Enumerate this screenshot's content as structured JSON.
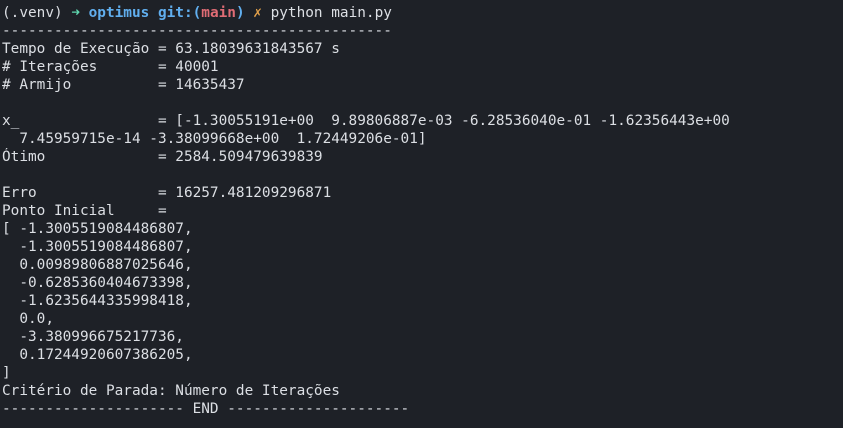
{
  "prompt": {
    "venv": "(.venv) ",
    "arrow": "➜ ",
    "dir": "optimus ",
    "git_open": "git:(",
    "branch": "main",
    "git_close": ")",
    "dirty": " ✗ ",
    "command": "python main.py"
  },
  "output": [
    "---------------------------------------------",
    "Tempo de Execução = 63.18039631843567 s",
    "# Iterações       = 40001",
    "# Armijo          = 14635437",
    "",
    "x_                = [-1.30055191e+00  9.89806887e-03 -6.28536040e-01 -1.62356443e+00",
    "  7.45959715e-14 -3.38099668e+00  1.72449206e-01]",
    "Ótimo             = 2584.509479639839",
    "",
    "Erro              = 16257.481209296871",
    "Ponto Inicial     =",
    "[ -1.3005519084486807,",
    "  -1.3005519084486807,",
    "  0.00989806887025646,",
    "  -0.6285360404673398,",
    "  -1.6235644335998418,",
    "  0.0,",
    "  -3.380996675217736,",
    "  0.17244920607386205,",
    "]",
    "Critério de Parada: Número de Iterações",
    "--------------------- END ---------------------"
  ],
  "colors": {
    "background": "#1e2127",
    "text": "#dcdfe4",
    "arrow": "#5fd7af",
    "dir": "#61afef",
    "branch": "#e06c75",
    "dirty": "#e5a24a"
  }
}
